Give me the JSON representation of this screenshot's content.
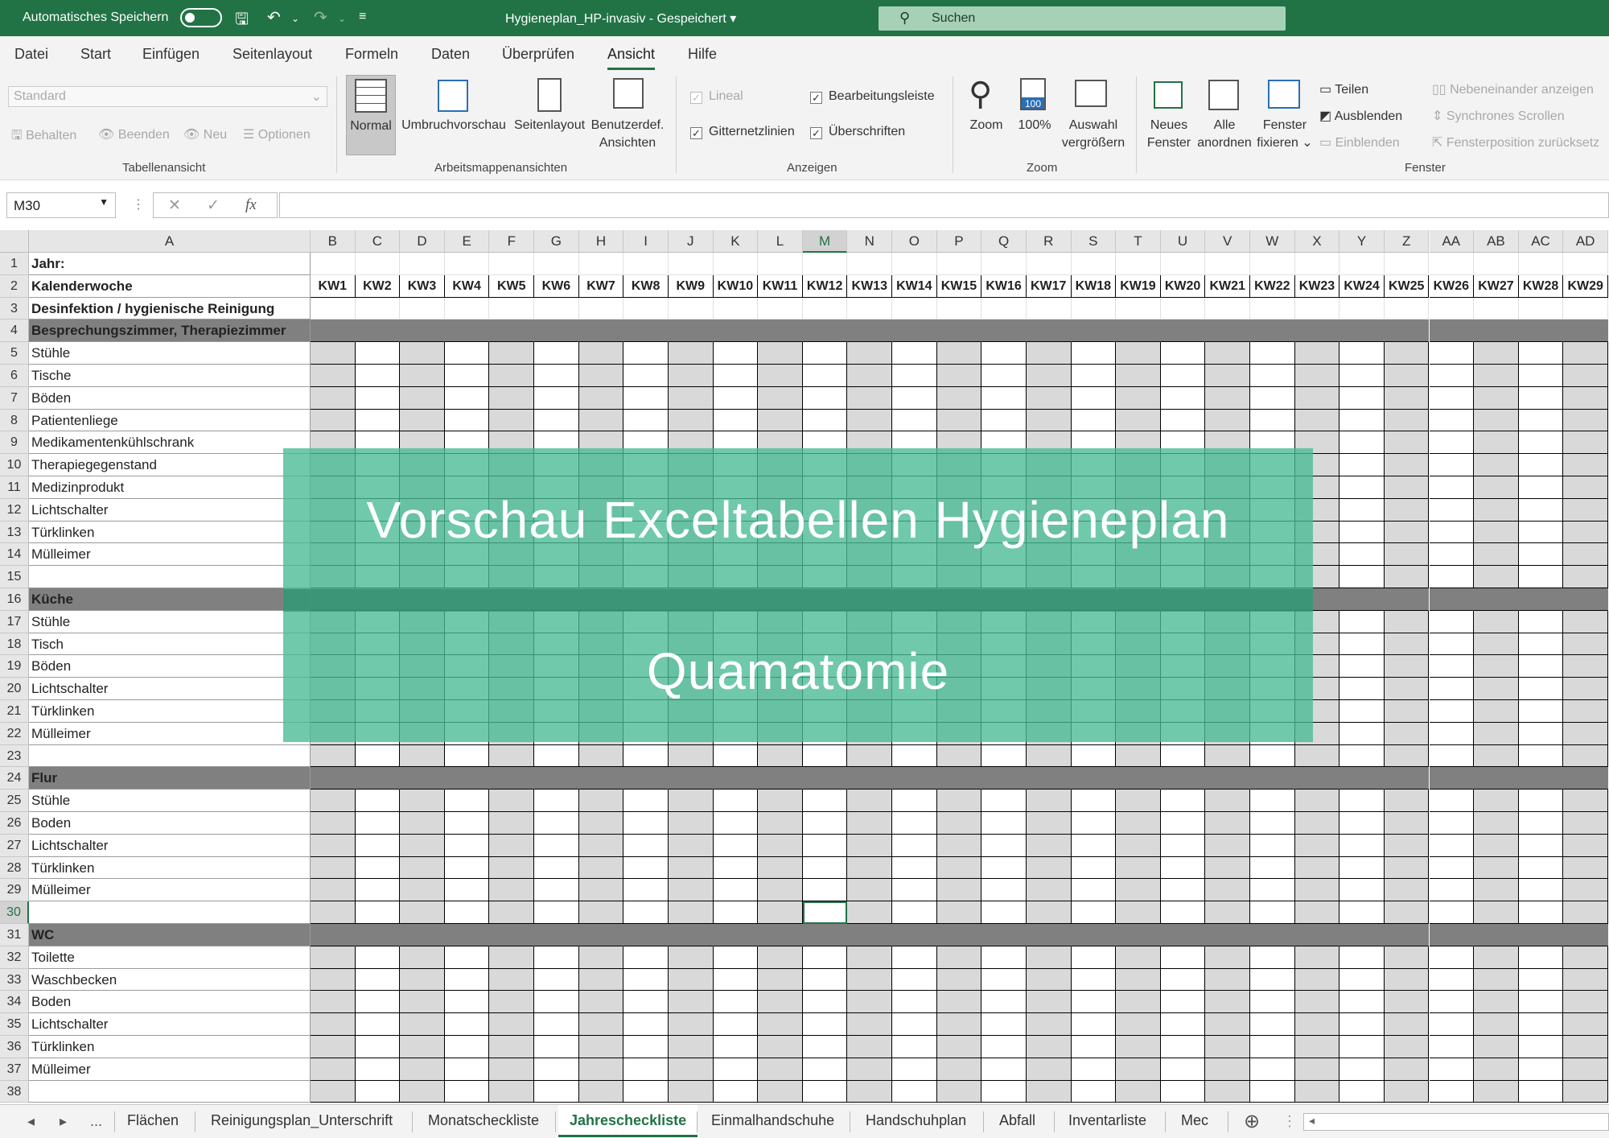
{
  "titlebar": {
    "autosave_label": "Automatisches Speichern",
    "document_title": "Hygieneplan_HP-invasiv - Gespeichert ▾",
    "search_placeholder": "Suchen"
  },
  "menu_tabs": [
    "Datei",
    "Start",
    "Einfügen",
    "Seitenlayout",
    "Formeln",
    "Daten",
    "Überprüfen",
    "Ansicht",
    "Hilfe"
  ],
  "active_menu_tab": "Ansicht",
  "ribbon": {
    "style_dropdown": "Standard",
    "sheetview_buttons": [
      "Behalten",
      "Beenden",
      "Neu",
      "Optionen"
    ],
    "group_tabellenansicht": "Tabellenansicht",
    "view_normal": "Normal",
    "view_umbruch": "Umbruchvorschau",
    "view_seitenlayout": "Seitenlayout",
    "view_benutzer_1": "Benutzerdef.",
    "view_benutzer_2": "Ansichten",
    "group_arbeitsmappen": "Arbeitsmappenansichten",
    "chk_lineal": "Lineal",
    "chk_bearbeitungsleiste": "Bearbeitungsleiste",
    "chk_gitternetz": "Gitternetzlinien",
    "chk_ueberschriften": "Überschriften",
    "group_anzeigen": "Anzeigen",
    "zoom_label": "Zoom",
    "zoom_100": "100%",
    "zoom_100_icon_text": "100",
    "auswahl_1": "Auswahl",
    "auswahl_2": "vergrößern",
    "group_zoom": "Zoom",
    "neues_1": "Neues",
    "neues_2": "Fenster",
    "alle_1": "Alle",
    "alle_2": "anordnen",
    "fixieren_1": "Fenster",
    "fixieren_2": "fixieren ⌄",
    "teilen": "Teilen",
    "ausblenden": "Ausblenden",
    "einblenden": "Einblenden",
    "nebeneinander": "Nebeneinander anzeigen",
    "synchron": "Synchrones Scrollen",
    "fensterposition": "Fensterposition zurücksetz",
    "group_fenster": "Fenster"
  },
  "formula_bar": {
    "name_box": "M30",
    "fx": "fx"
  },
  "columns": [
    "A",
    "B",
    "C",
    "D",
    "E",
    "F",
    "G",
    "H",
    "I",
    "J",
    "K",
    "L",
    "M",
    "N",
    "O",
    "P",
    "Q",
    "R",
    "S",
    "T",
    "U",
    "V",
    "W",
    "X",
    "Y",
    "Z",
    "AA",
    "AB",
    "AC",
    "AD"
  ],
  "selected_column": "M",
  "selected_row": 30,
  "rows": [
    {
      "n": "1",
      "a": "Jahr:",
      "bold": true,
      "kind": "plain"
    },
    {
      "n": "2",
      "a": "Kalenderwoche",
      "bold": true,
      "kind": "kw"
    },
    {
      "n": "3",
      "a": "Desinfektion / hygienische Reinigung",
      "bold": true,
      "kind": "plain"
    },
    {
      "n": "4",
      "a": "Besprechungszimmer, Therapiezimmer",
      "bold": true,
      "kind": "section"
    },
    {
      "n": "5",
      "a": "Stühle",
      "kind": "item"
    },
    {
      "n": "6",
      "a": "Tische",
      "kind": "item"
    },
    {
      "n": "7",
      "a": "Böden",
      "kind": "item"
    },
    {
      "n": "8",
      "a": "Patientenliege",
      "kind": "item"
    },
    {
      "n": "9",
      "a": "Medikamentenkühlschrank",
      "kind": "item"
    },
    {
      "n": "10",
      "a": "Therapiegegenstand",
      "kind": "item"
    },
    {
      "n": "11",
      "a": "Medizinprodukt",
      "kind": "item"
    },
    {
      "n": "12",
      "a": "Lichtschalter",
      "kind": "item"
    },
    {
      "n": "13",
      "a": "Türklinken",
      "kind": "item"
    },
    {
      "n": "14",
      "a": "Mülleimer",
      "kind": "item"
    },
    {
      "n": "15",
      "a": "",
      "kind": "item"
    },
    {
      "n": "16",
      "a": "Küche",
      "bold": true,
      "kind": "section"
    },
    {
      "n": "17",
      "a": "Stühle",
      "kind": "item"
    },
    {
      "n": "18",
      "a": "Tisch",
      "kind": "item"
    },
    {
      "n": "19",
      "a": "Böden",
      "kind": "item"
    },
    {
      "n": "20",
      "a": "Lichtschalter",
      "kind": "item"
    },
    {
      "n": "21",
      "a": "Türklinken",
      "kind": "item"
    },
    {
      "n": "22",
      "a": "Mülleimer",
      "kind": "item"
    },
    {
      "n": "23",
      "a": "",
      "kind": "item"
    },
    {
      "n": "24",
      "a": "Flur",
      "bold": true,
      "kind": "section"
    },
    {
      "n": "25",
      "a": "Stühle",
      "kind": "item"
    },
    {
      "n": "26",
      "a": "Boden",
      "kind": "item"
    },
    {
      "n": "27",
      "a": "Lichtschalter",
      "kind": "item"
    },
    {
      "n": "28",
      "a": "Türklinken",
      "kind": "item"
    },
    {
      "n": "29",
      "a": "Mülleimer",
      "kind": "item"
    },
    {
      "n": "30",
      "a": "",
      "kind": "item"
    },
    {
      "n": "31",
      "a": "WC",
      "bold": true,
      "kind": "section"
    },
    {
      "n": "32",
      "a": "Toilette",
      "kind": "item"
    },
    {
      "n": "33",
      "a": "Waschbecken",
      "kind": "item"
    },
    {
      "n": "34",
      "a": "Boden",
      "kind": "item"
    },
    {
      "n": "35",
      "a": "Lichtschalter",
      "kind": "item"
    },
    {
      "n": "36",
      "a": "Türklinken",
      "kind": "item"
    },
    {
      "n": "37",
      "a": "Mülleimer",
      "kind": "item"
    },
    {
      "n": "38",
      "a": "",
      "kind": "item"
    }
  ],
  "week_labels": [
    "KW1",
    "KW2",
    "KW3",
    "KW4",
    "KW5",
    "KW6",
    "KW7",
    "KW8",
    "KW9",
    "KW10",
    "KW11",
    "KW12",
    "KW13",
    "KW14",
    "KW15",
    "KW16",
    "KW17",
    "KW18",
    "KW19",
    "KW20",
    "KW21",
    "KW22",
    "KW23",
    "KW24",
    "KW25",
    "KW26",
    "KW27",
    "KW28",
    "KW29"
  ],
  "overlay": {
    "title": "Vorschau Exceltabellen Hygieneplan",
    "subtitle": "Quamatomie"
  },
  "sheet_tabs": [
    "Flächen",
    "Reinigungsplan_Unterschrift",
    "Monatscheckliste",
    "Jahrescheckliste",
    "Einmalhandschuhe",
    "Handschuhplan",
    "Abfall",
    "Inventarliste",
    "Mec"
  ],
  "active_sheet": "Jahrescheckliste",
  "tab_nav": {
    "prev": "◂",
    "next": "▸",
    "more": "...",
    "add": "⊕"
  },
  "colors": {
    "excel_green": "#217346",
    "section_gray": "#808080",
    "shade_gray": "#d9d9d9",
    "overlay_green": "#48ba93"
  }
}
